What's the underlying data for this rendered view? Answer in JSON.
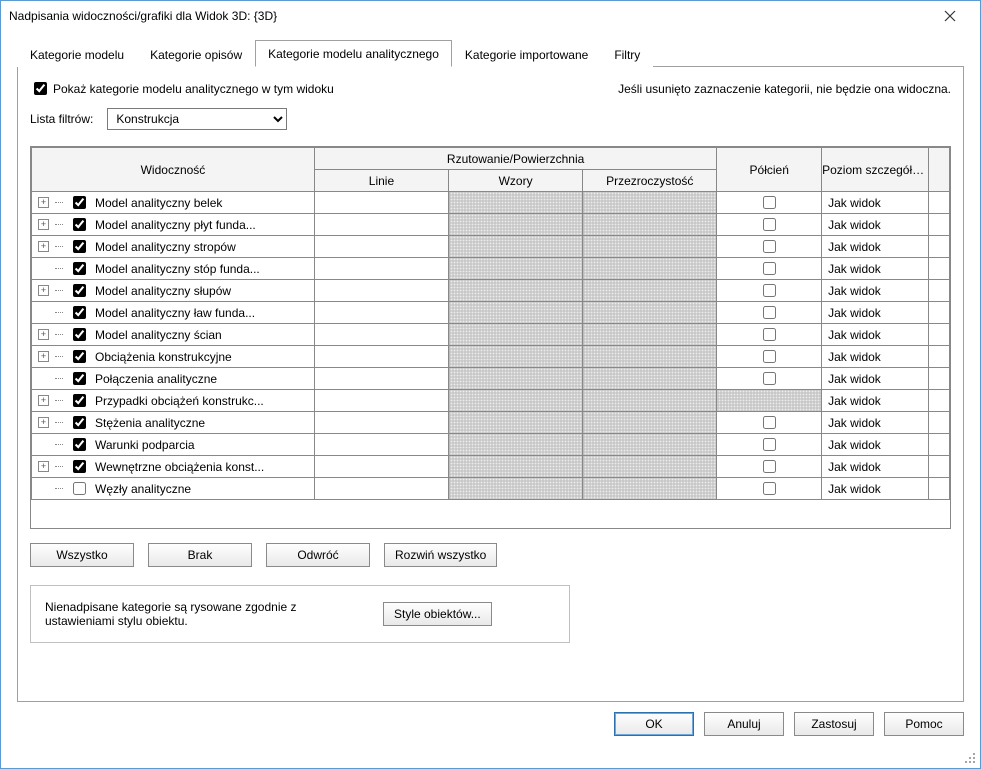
{
  "window": {
    "title": "Nadpisania widoczności/grafiki dla Widok 3D: {3D}"
  },
  "tabs": {
    "model": "Kategorie modelu",
    "annot": "Kategorie opisów",
    "analytical": "Kategorie modelu analitycznego",
    "imported": "Kategorie importowane",
    "filters": "Filtry"
  },
  "panel": {
    "show_checkbox_label": "Pokaż kategorie modelu analitycznego w tym widoku",
    "note": "Jeśli usunięto zaznaczenie kategorii, nie będzie ona widoczna.",
    "filter_label": "Lista filtrów:",
    "filter_value": "Konstrukcja"
  },
  "headers": {
    "visibility": "Widoczność",
    "projection": "Rzutowanie/Powierzchnia",
    "lines": "Linie",
    "patterns": "Wzory",
    "transparency": "Przezroczystość",
    "halftone": "Półcień",
    "detail": "Poziom szczegółowo...",
    "byview": "Jak widok"
  },
  "rows": [
    {
      "label": "Model analityczny belek",
      "checked": true,
      "expand": true,
      "halftone": "unchecked"
    },
    {
      "label": "Model analityczny płyt funda...",
      "checked": true,
      "expand": true,
      "halftone": "unchecked"
    },
    {
      "label": "Model analityczny stropów",
      "checked": true,
      "expand": true,
      "halftone": "unchecked"
    },
    {
      "label": "Model analityczny stóp funda...",
      "checked": true,
      "expand": false,
      "halftone": "unchecked"
    },
    {
      "label": "Model analityczny słupów",
      "checked": true,
      "expand": true,
      "halftone": "unchecked"
    },
    {
      "label": "Model analityczny ław funda...",
      "checked": true,
      "expand": false,
      "halftone": "unchecked"
    },
    {
      "label": "Model analityczny ścian",
      "checked": true,
      "expand": true,
      "halftone": "unchecked"
    },
    {
      "label": "Obciążenia konstrukcyjne",
      "checked": true,
      "expand": true,
      "halftone": "unchecked"
    },
    {
      "label": "Połączenia analityczne",
      "checked": true,
      "expand": false,
      "halftone": "unchecked"
    },
    {
      "label": "Przypadki obciążeń konstrukc...",
      "checked": true,
      "expand": true,
      "halftone": "disabled"
    },
    {
      "label": "Stężenia analityczne",
      "checked": true,
      "expand": true,
      "halftone": "unchecked"
    },
    {
      "label": "Warunki podparcia",
      "checked": true,
      "expand": false,
      "halftone": "unchecked"
    },
    {
      "label": "Wewnętrzne obciążenia konst...",
      "checked": true,
      "expand": true,
      "halftone": "unchecked"
    },
    {
      "label": "Węzły analityczne",
      "checked": false,
      "expand": false,
      "halftone": "unchecked"
    }
  ],
  "buttons": {
    "all": "Wszystko",
    "none": "Brak",
    "invert": "Odwróć",
    "expand_all": "Rozwiń wszystko",
    "object_styles": "Style obiektów...",
    "ok": "OK",
    "cancel": "Anuluj",
    "apply": "Zastosuj",
    "help": "Pomoc"
  },
  "styles_note": "Nienadpisane kategorie są rysowane zgodnie z ustawieniami stylu obiektu."
}
